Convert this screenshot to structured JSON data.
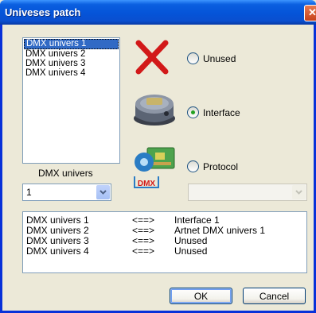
{
  "window": {
    "title": "Univeses patch",
    "close_glyph": "✕"
  },
  "universes_list": {
    "items": [
      "DMX univers 1",
      "DMX univers 2",
      "DMX univers 3",
      "DMX univers 4"
    ],
    "selected_index": 0
  },
  "universe_picker": {
    "label": "DMX univers",
    "value": "1",
    "arrow_icon": "chevron-down-icon"
  },
  "options": {
    "unused": {
      "label": "Unused",
      "checked": false,
      "icon": "red-x-icon"
    },
    "interface": {
      "label": "Interface",
      "checked": true,
      "icon": "dmx-interface-device-icon"
    },
    "protocol": {
      "label": "Protocol",
      "checked": false,
      "icon": "dmx-protocol-icon"
    }
  },
  "protocol_select": {
    "value": "",
    "enabled": false
  },
  "mapping": {
    "rows": [
      {
        "universe": "DMX univers 1",
        "arrow": "<==>",
        "target": "Interface 1"
      },
      {
        "universe": "DMX univers 2",
        "arrow": "<==>",
        "target": "Artnet DMX univers 1"
      },
      {
        "universe": "DMX univers 3",
        "arrow": "<==>",
        "target": "Unused"
      },
      {
        "universe": "DMX univers 4",
        "arrow": "<==>",
        "target": "Unused"
      }
    ]
  },
  "buttons": {
    "ok": "OK",
    "cancel": "Cancel"
  },
  "colors": {
    "titlebar": "#0554d8",
    "dialog_bg": "#ece9d8",
    "border": "#7f9db9"
  }
}
